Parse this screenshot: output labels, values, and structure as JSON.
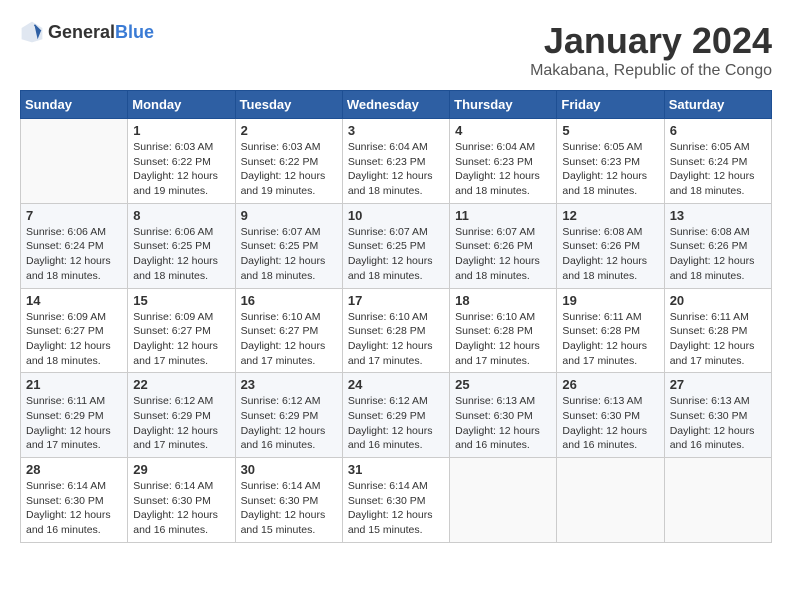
{
  "header": {
    "logo_general": "General",
    "logo_blue": "Blue",
    "main_title": "January 2024",
    "subtitle": "Makabana, Republic of the Congo"
  },
  "calendar": {
    "days_of_week": [
      "Sunday",
      "Monday",
      "Tuesday",
      "Wednesday",
      "Thursday",
      "Friday",
      "Saturday"
    ],
    "weeks": [
      [
        {
          "day": "",
          "info": ""
        },
        {
          "day": "1",
          "info": "Sunrise: 6:03 AM\nSunset: 6:22 PM\nDaylight: 12 hours and 19 minutes."
        },
        {
          "day": "2",
          "info": "Sunrise: 6:03 AM\nSunset: 6:22 PM\nDaylight: 12 hours and 19 minutes."
        },
        {
          "day": "3",
          "info": "Sunrise: 6:04 AM\nSunset: 6:23 PM\nDaylight: 12 hours and 18 minutes."
        },
        {
          "day": "4",
          "info": "Sunrise: 6:04 AM\nSunset: 6:23 PM\nDaylight: 12 hours and 18 minutes."
        },
        {
          "day": "5",
          "info": "Sunrise: 6:05 AM\nSunset: 6:23 PM\nDaylight: 12 hours and 18 minutes."
        },
        {
          "day": "6",
          "info": "Sunrise: 6:05 AM\nSunset: 6:24 PM\nDaylight: 12 hours and 18 minutes."
        }
      ],
      [
        {
          "day": "7",
          "info": "Sunrise: 6:06 AM\nSunset: 6:24 PM\nDaylight: 12 hours and 18 minutes."
        },
        {
          "day": "8",
          "info": "Sunrise: 6:06 AM\nSunset: 6:25 PM\nDaylight: 12 hours and 18 minutes."
        },
        {
          "day": "9",
          "info": "Sunrise: 6:07 AM\nSunset: 6:25 PM\nDaylight: 12 hours and 18 minutes."
        },
        {
          "day": "10",
          "info": "Sunrise: 6:07 AM\nSunset: 6:25 PM\nDaylight: 12 hours and 18 minutes."
        },
        {
          "day": "11",
          "info": "Sunrise: 6:07 AM\nSunset: 6:26 PM\nDaylight: 12 hours and 18 minutes."
        },
        {
          "day": "12",
          "info": "Sunrise: 6:08 AM\nSunset: 6:26 PM\nDaylight: 12 hours and 18 minutes."
        },
        {
          "day": "13",
          "info": "Sunrise: 6:08 AM\nSunset: 6:26 PM\nDaylight: 12 hours and 18 minutes."
        }
      ],
      [
        {
          "day": "14",
          "info": "Sunrise: 6:09 AM\nSunset: 6:27 PM\nDaylight: 12 hours and 18 minutes."
        },
        {
          "day": "15",
          "info": "Sunrise: 6:09 AM\nSunset: 6:27 PM\nDaylight: 12 hours and 17 minutes."
        },
        {
          "day": "16",
          "info": "Sunrise: 6:10 AM\nSunset: 6:27 PM\nDaylight: 12 hours and 17 minutes."
        },
        {
          "day": "17",
          "info": "Sunrise: 6:10 AM\nSunset: 6:28 PM\nDaylight: 12 hours and 17 minutes."
        },
        {
          "day": "18",
          "info": "Sunrise: 6:10 AM\nSunset: 6:28 PM\nDaylight: 12 hours and 17 minutes."
        },
        {
          "day": "19",
          "info": "Sunrise: 6:11 AM\nSunset: 6:28 PM\nDaylight: 12 hours and 17 minutes."
        },
        {
          "day": "20",
          "info": "Sunrise: 6:11 AM\nSunset: 6:28 PM\nDaylight: 12 hours and 17 minutes."
        }
      ],
      [
        {
          "day": "21",
          "info": "Sunrise: 6:11 AM\nSunset: 6:29 PM\nDaylight: 12 hours and 17 minutes."
        },
        {
          "day": "22",
          "info": "Sunrise: 6:12 AM\nSunset: 6:29 PM\nDaylight: 12 hours and 17 minutes."
        },
        {
          "day": "23",
          "info": "Sunrise: 6:12 AM\nSunset: 6:29 PM\nDaylight: 12 hours and 16 minutes."
        },
        {
          "day": "24",
          "info": "Sunrise: 6:12 AM\nSunset: 6:29 PM\nDaylight: 12 hours and 16 minutes."
        },
        {
          "day": "25",
          "info": "Sunrise: 6:13 AM\nSunset: 6:30 PM\nDaylight: 12 hours and 16 minutes."
        },
        {
          "day": "26",
          "info": "Sunrise: 6:13 AM\nSunset: 6:30 PM\nDaylight: 12 hours and 16 minutes."
        },
        {
          "day": "27",
          "info": "Sunrise: 6:13 AM\nSunset: 6:30 PM\nDaylight: 12 hours and 16 minutes."
        }
      ],
      [
        {
          "day": "28",
          "info": "Sunrise: 6:14 AM\nSunset: 6:30 PM\nDaylight: 12 hours and 16 minutes."
        },
        {
          "day": "29",
          "info": "Sunrise: 6:14 AM\nSunset: 6:30 PM\nDaylight: 12 hours and 16 minutes."
        },
        {
          "day": "30",
          "info": "Sunrise: 6:14 AM\nSunset: 6:30 PM\nDaylight: 12 hours and 15 minutes."
        },
        {
          "day": "31",
          "info": "Sunrise: 6:14 AM\nSunset: 6:30 PM\nDaylight: 12 hours and 15 minutes."
        },
        {
          "day": "",
          "info": ""
        },
        {
          "day": "",
          "info": ""
        },
        {
          "day": "",
          "info": ""
        }
      ]
    ]
  }
}
